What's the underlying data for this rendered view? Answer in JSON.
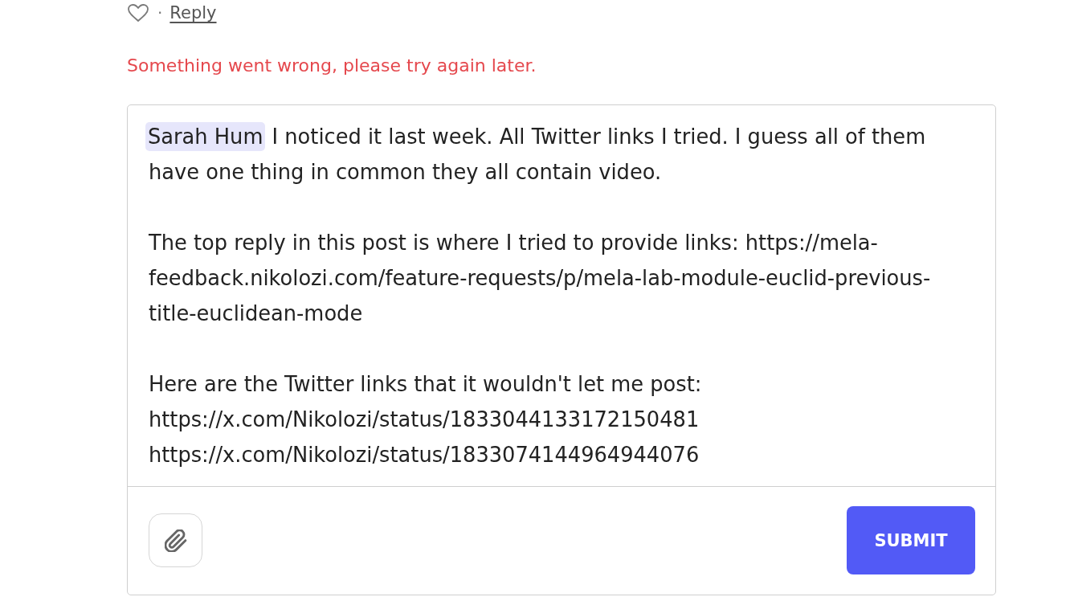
{
  "comment_actions": {
    "liked": false,
    "separator": "·",
    "reply_label": "Reply"
  },
  "error_message": "Something went wrong, please try again later.",
  "editor": {
    "paragraphs": [
      {
        "mention": "Sarah Hum",
        "lines": [
          "I noticed it last week. All Twitter links I tried. I guess all of them have one thing in common they all contain video."
        ]
      },
      {
        "lines": [
          "The top reply in this post is where I tried to provide links: https://mela-feedback.nikolozi.com/feature-requests/p/mela-lab-module-euclid-previous-title-euclidean-mode"
        ]
      },
      {
        "lines": [
          "Here are the Twitter links that it wouldn't let me post:",
          "https://x.com/Nikolozi/status/1833044133172150481",
          "https://x.com/Nikolozi/status/1833074144964944076"
        ]
      }
    ],
    "submit_label": "SUBMIT"
  }
}
